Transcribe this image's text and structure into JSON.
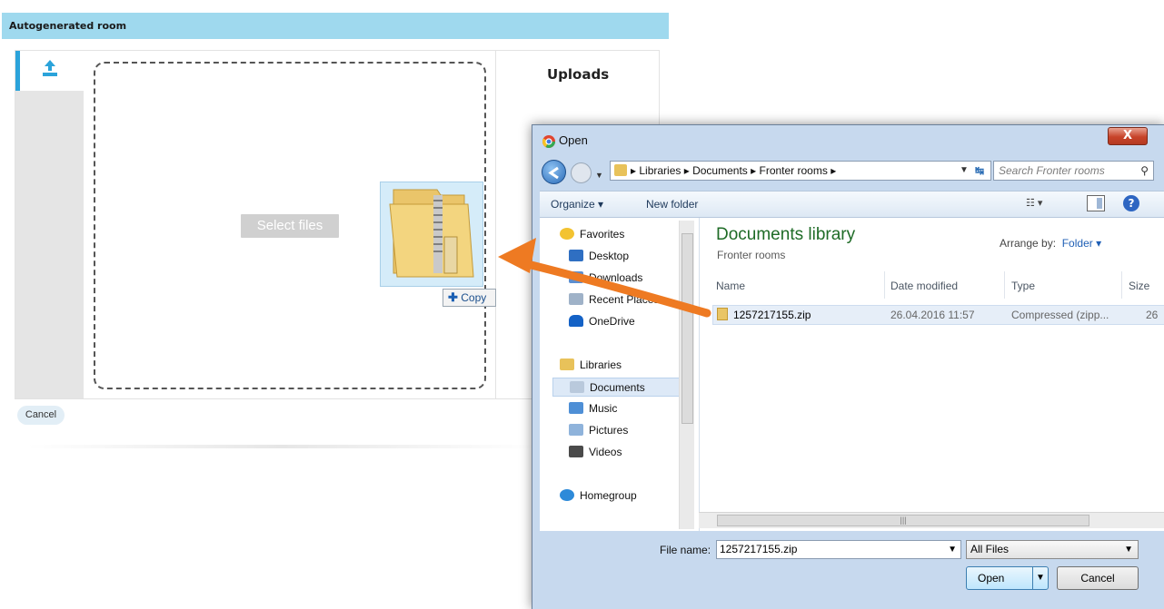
{
  "app": {
    "header_title": "Autogenerated room",
    "select_files_label": "Select files",
    "uploads_title": "Uploads",
    "cancel_label": "Cancel",
    "drag_badge_label": "Copy",
    "accent_color": "#2ba3da",
    "header_color": "#9fd9ee"
  },
  "dialog": {
    "title": "Open",
    "close_label": "X",
    "address": {
      "segments": [
        "Libraries",
        "Documents",
        "Fronter rooms"
      ]
    },
    "search_placeholder": "Search Fronter rooms",
    "toolbar": {
      "organize_label": "Organize ▾",
      "new_folder_label": "New folder"
    },
    "nav": {
      "favorites": "Favorites",
      "desktop": "Desktop",
      "downloads": "Downloads",
      "recent_places": "Recent Places",
      "onedrive": "OneDrive",
      "libraries": "Libraries",
      "documents": "Documents",
      "music": "Music",
      "pictures": "Pictures",
      "videos": "Videos",
      "homegroup": "Homegroup"
    },
    "library_title": "Documents library",
    "library_subtitle": "Fronter rooms",
    "arrange_label": "Arrange by:",
    "arrange_value": "Folder ▾",
    "columns": {
      "name": "Name",
      "date_modified": "Date modified",
      "type": "Type",
      "size": "Size"
    },
    "files": [
      {
        "name": "1257217155.zip",
        "date_modified": "26.04.2016 11:57",
        "type": "Compressed (zipp...",
        "size": "26"
      }
    ],
    "file_name_label": "File name:",
    "file_name_value": "1257217155.zip",
    "file_type_value": "All Files",
    "open_label": "Open",
    "cancel_label": "Cancel"
  }
}
